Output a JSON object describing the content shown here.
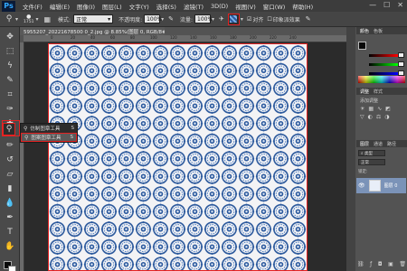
{
  "app": {
    "logo": "Ps"
  },
  "menu": [
    "文件(F)",
    "编辑(E)",
    "图像(I)",
    "图层(L)",
    "文字(Y)",
    "选择(S)",
    "滤镜(T)",
    "3D(D)",
    "视图(V)",
    "窗口(W)",
    "帮助(H)"
  ],
  "window_controls": [
    "—",
    "☐",
    "✕"
  ],
  "options": {
    "brush_size": "1751",
    "mode_label": "模式:",
    "mode_value": "正常",
    "opacity_label": "不透明度:",
    "opacity_value": "100%",
    "flow_label": "流量:",
    "flow_value": "100%",
    "aligned_label": "对齐",
    "sample_label": "样本:",
    "sample_value": "当前图层"
  },
  "document": {
    "tab_title": "5955207_20221678500 0_2.jpg @ 8.85%(图层 0, RGB/8#)",
    "close": "×"
  },
  "ruler_ticks": [
    "0",
    "20",
    "40",
    "60",
    "80",
    "100",
    "120",
    "140",
    "160",
    "180",
    "200",
    "220",
    "240"
  ],
  "tool_flyout": {
    "items": [
      {
        "icon": "clone-stamp-icon",
        "label": "仿制图章工具",
        "shortcut": "S"
      },
      {
        "icon": "pattern-stamp-icon",
        "label": "图案图章工具",
        "shortcut": "S"
      }
    ]
  },
  "panels": {
    "color_tabs": [
      "颜色",
      "色板"
    ],
    "adjust_tabs": [
      "调整",
      "样式"
    ],
    "adjust_hint": "添加调整",
    "layers_tabs": [
      "图层",
      "通道",
      "路径"
    ],
    "kind_label": "类型",
    "blend_mode": "正常",
    "lock_label": "锁定:",
    "layer_name": "图层 0"
  },
  "colors": {
    "accent": "#e52222",
    "pattern_blue": "#2e5b9e",
    "layer_selected": "#7b93b8"
  }
}
